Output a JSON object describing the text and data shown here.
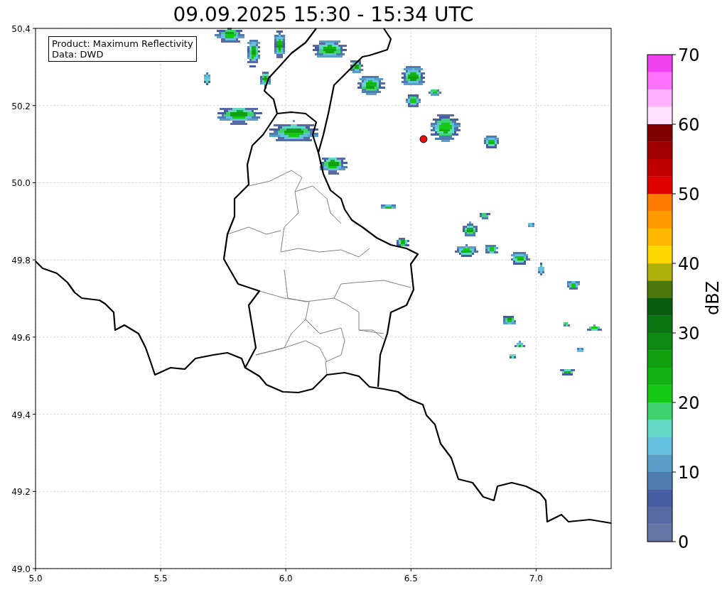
{
  "title": "09.09.2025 15:30 - 15:34 UTC",
  "legend": [
    "Product: Maximum Reflectivity",
    "Data: DWD"
  ],
  "map": {
    "xticks": [
      "5.0",
      "5.5",
      "6.0",
      "6.5",
      "7.0"
    ],
    "yticks": [
      "50.4",
      "50.2",
      "50.0",
      "49.8",
      "49.6",
      "49.4",
      "49.2",
      "49.0"
    ]
  },
  "colorbar": {
    "label": "dBZ",
    "ticks": [
      "70",
      "60",
      "50",
      "40",
      "30",
      "20",
      "10",
      "0"
    ],
    "bands": [
      {
        "color": "#f040f0"
      },
      {
        "color": "#ff70ff"
      },
      {
        "color": "#ffb0ff"
      },
      {
        "color": "#ffe0ff"
      },
      {
        "color": "#800000"
      },
      {
        "color": "#a00000"
      },
      {
        "color": "#c00000"
      },
      {
        "color": "#e00000"
      },
      {
        "color": "#ff7c00"
      },
      {
        "color": "#ff9a00"
      },
      {
        "color": "#ffb800"
      },
      {
        "color": "#ffd800"
      },
      {
        "color": "#b0b00a"
      },
      {
        "color": "#4a780c"
      },
      {
        "color": "#085c10"
      },
      {
        "color": "#0a7412"
      },
      {
        "color": "#0c8a12"
      },
      {
        "color": "#10a010"
      },
      {
        "color": "#12b414"
      },
      {
        "color": "#14c814"
      },
      {
        "color": "#3ed270"
      },
      {
        "color": "#62d8c4"
      },
      {
        "color": "#64c0dc"
      },
      {
        "color": "#5c9cc8"
      },
      {
        "color": "#4e7cb0"
      },
      {
        "color": "#465ea0"
      },
      {
        "color": "#566aa4"
      },
      {
        "color": "#6474a4"
      }
    ]
  }
}
